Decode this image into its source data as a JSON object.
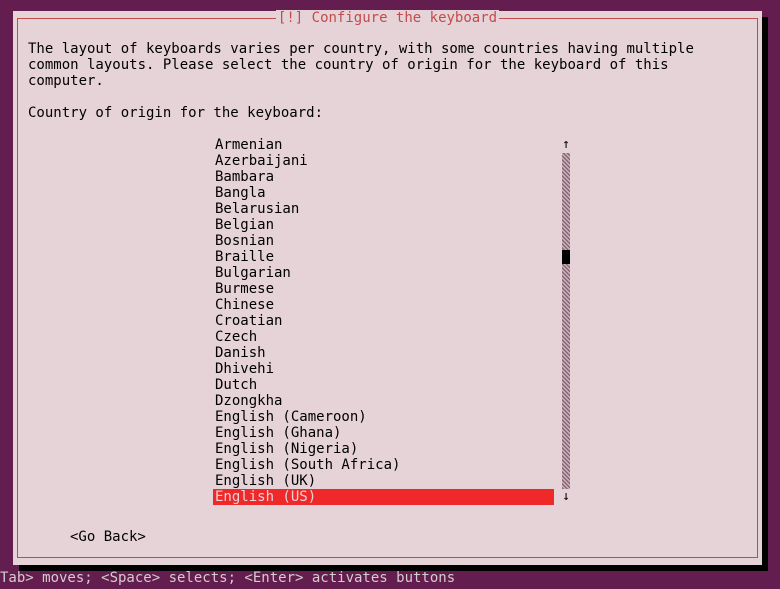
{
  "colors": {
    "bg": "#641d4f",
    "panel": "#e5d3d8",
    "accent": "#c14c4b",
    "highlight": "#ef2929"
  },
  "title": "[!] Configure the keyboard",
  "description": "The layout of keyboards varies per country, with some countries having multiple common layouts. Please select the country of origin for the keyboard of this computer.",
  "prompt": "Country of origin for the keyboard:",
  "list": {
    "items": [
      "Armenian",
      "Azerbaijani",
      "Bambara",
      "Bangla",
      "Belarusian",
      "Belgian",
      "Bosnian",
      "Braille",
      "Bulgarian",
      "Burmese",
      "Chinese",
      "Croatian",
      "Czech",
      "Danish",
      "Dhivehi",
      "Dutch",
      "Dzongkha",
      "English (Cameroon)",
      "English (Ghana)",
      "English (Nigeria)",
      "English (South Africa)",
      "English (UK)",
      "English (US)"
    ],
    "selected_index": 22,
    "scroll": {
      "up_arrow": "↑",
      "down_arrow": "↓",
      "thumb_index": 7,
      "visible_count": 23
    }
  },
  "go_back": "<Go Back>",
  "footer": "Tab> moves; <Space> selects; <Enter> activates buttons"
}
